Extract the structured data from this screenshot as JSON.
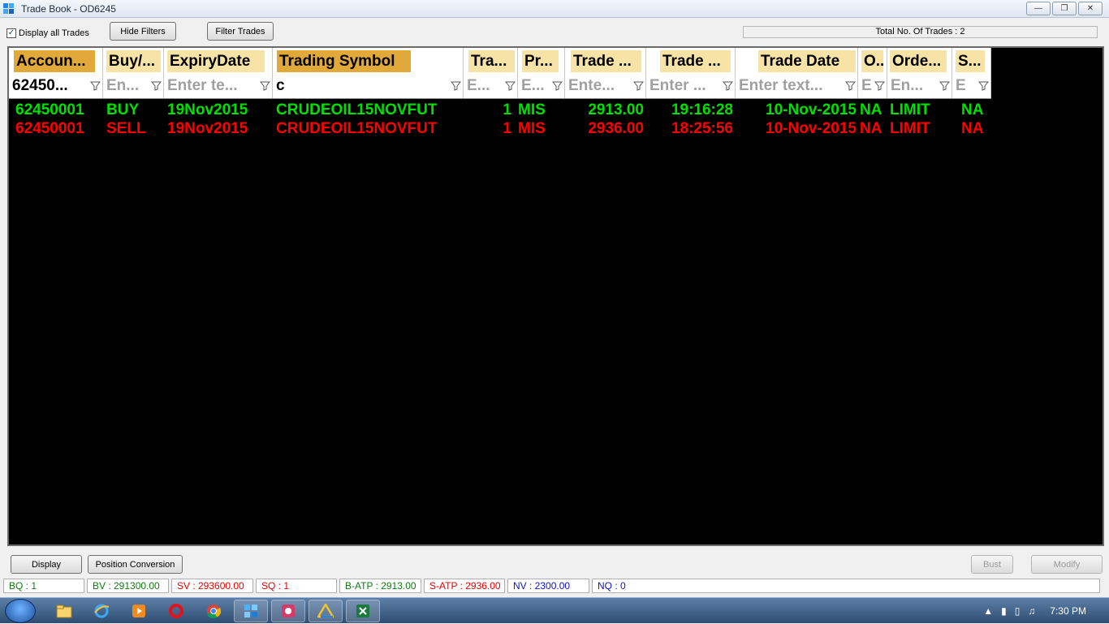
{
  "window": {
    "title": "Trade Book - OD6245"
  },
  "toolbar": {
    "display_all_label": "Display all Trades",
    "hide_filters_label": "Hide Filters",
    "filter_trades_label": "Filter Trades",
    "total_trades_label": "Total No. Of Trades : 2"
  },
  "columns": [
    "Accoun...",
    "Buy/...",
    "ExpiryDate",
    "Trading Symbol",
    "Tra...",
    "Pr...",
    "Trade ...",
    "Trade ...",
    "Trade Date",
    "O...",
    "Orde...",
    "S..."
  ],
  "filters": [
    "62450...",
    "En...",
    "Enter te...",
    "c",
    "E...",
    "E...",
    "Ente...",
    "Enter ...",
    "Enter text...",
    "E",
    "En...",
    "E"
  ],
  "rows": [
    {
      "account": "62450001",
      "side": "BUY",
      "expiry": "19Nov2015",
      "symbol": "CRUDEOIL15NOVFUT",
      "qty": "1",
      "product": "MIS",
      "price": "2913.00",
      "time": "19:16:28",
      "date": "10-Nov-2015",
      "o": "NA",
      "order": "LIMIT",
      "s": "NA"
    },
    {
      "account": "62450001",
      "side": "SELL",
      "expiry": "19Nov2015",
      "symbol": "CRUDEOIL15NOVFUT",
      "qty": "1",
      "product": "MIS",
      "price": "2936.00",
      "time": "18:25:56",
      "date": "10-Nov-2015",
      "o": "NA",
      "order": "LIMIT",
      "s": "NA"
    }
  ],
  "bottom": {
    "display_label": "Display",
    "position_conversion_label": "Position Conversion",
    "bust_label": "Bust",
    "modify_label": "Modify"
  },
  "status": {
    "bq": "BQ : 1",
    "bv": "BV : 291300.00",
    "sv": "SV : 293600.00",
    "sq": "SQ : 1",
    "batp": "B-ATP : 2913.00",
    "satp": "S-ATP : 2936.00",
    "nv": "NV : 2300.00",
    "nq": "NQ : 0"
  },
  "taskbar": {
    "clock": "7:30 PM"
  },
  "colors": {
    "buy": "#00e000",
    "sell": "#ff0000",
    "header_highlight": "#e0a93a",
    "header_soft": "#f7e3a6"
  }
}
